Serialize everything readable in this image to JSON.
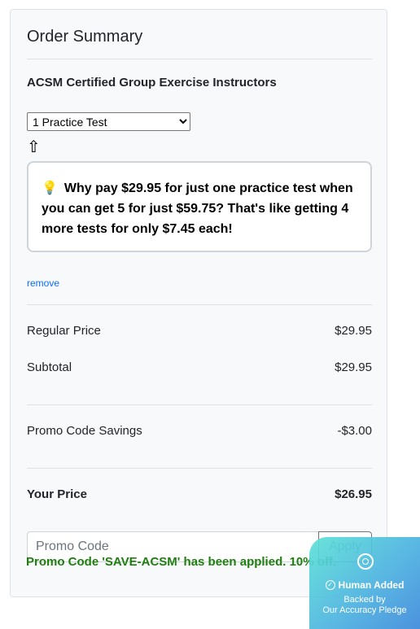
{
  "summary": {
    "title": "Order Summary",
    "product_name": "ACSM Certified Group Exercise Instructors",
    "quantity": {
      "selected": "1 Practice Test",
      "options": [
        "1 Practice Test"
      ]
    },
    "arrow_icon": "up-arrow-icon",
    "upsell": {
      "icon": "lightbulb-icon",
      "message": "Why pay $29.95 for just one practice test when you can get 5 for just $59.75? That's like getting 4 more tests for only $7.45 each!"
    },
    "remove_label": "remove"
  },
  "pricing": {
    "regular_label": "Regular Price",
    "regular_value": "$29.95",
    "subtotal_label": "Subtotal",
    "subtotal_value": "$29.95",
    "savings_label": "Promo Code Savings",
    "savings_value": "-$3.00",
    "total_label": "Your Price",
    "total_value": "$26.95"
  },
  "promo": {
    "placeholder": "Promo Code",
    "apply_label": "Apply",
    "applied_message": "Promo Code 'SAVE-ACSM' has been applied. 10% off."
  },
  "pledge_badge": {
    "headline": "Human Added",
    "line1": "Backed by",
    "line2": "Our Accuracy Pledge"
  },
  "colors": {
    "link": "#0d6efd",
    "success": "#1e7e0e",
    "badge_gradient_start": "#5ce2d6",
    "badge_gradient_end": "#428cdc"
  }
}
